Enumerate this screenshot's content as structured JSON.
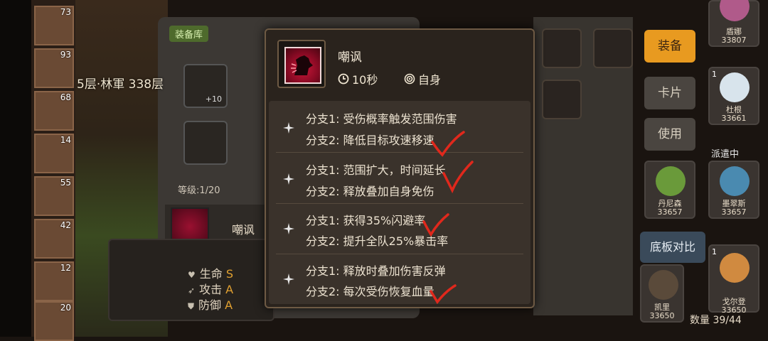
{
  "roster_levels": [
    "73",
    "93",
    "68",
    "14",
    "55",
    "42",
    "12",
    "20"
  ],
  "scene": {
    "floor_label": "5层·林軍 338层"
  },
  "equipment_panel": {
    "tab_label": "装备库",
    "slot_plus": "+10",
    "level_label": "等级:1/20",
    "skill_name": "嘲讽",
    "stats": [
      {
        "label": "生命",
        "grade": "S"
      },
      {
        "label": "攻击",
        "grade": "A"
      },
      {
        "label": "防御",
        "grade": "A"
      }
    ]
  },
  "right_menu": {
    "equip_label": "装备",
    "card_label": "卡片",
    "use_label": "使用",
    "compare_label": "底板对比",
    "dispatch_label": "派遣中",
    "count_label": "数量 39/44"
  },
  "heroes": [
    {
      "name": "盾娜",
      "power": "33807",
      "rank": ""
    },
    {
      "name": "杜根",
      "power": "33661",
      "rank": "1"
    },
    {
      "name": "丹尼森",
      "power": "33657",
      "rank": ""
    },
    {
      "name": "墨翠斯",
      "power": "33657",
      "rank": ""
    },
    {
      "name": "凯里",
      "power": "33650",
      "rank": ""
    },
    {
      "name": "戈尔登",
      "power": "33650",
      "rank": "1"
    }
  ],
  "popup": {
    "skill_name": "嘲讽",
    "cooldown": "10秒",
    "target": "自身",
    "branches": [
      {
        "b1": "分支1: 受伤概率触发范围伤害",
        "b2": "分支2: 降低目标攻速移速"
      },
      {
        "b1": "分支1: 范围扩大，时间延长",
        "b2": "分支2: 释放叠加自身免伤"
      },
      {
        "b1": "分支1: 获得35%闪避率",
        "b2": "分支2: 提升全队25%暴击率"
      },
      {
        "b1": "分支1: 释放时叠加伤害反弹",
        "b2": "分支2: 每次受伤恢复血量"
      }
    ]
  },
  "colors": {
    "accent": "#e89a20",
    "check_red": "#e0281c",
    "popup_bg": "#2a231d"
  },
  "icons": [
    "clock-icon",
    "target-icon",
    "sparkle-icon",
    "lock-icon",
    "checkmark-icon"
  ]
}
